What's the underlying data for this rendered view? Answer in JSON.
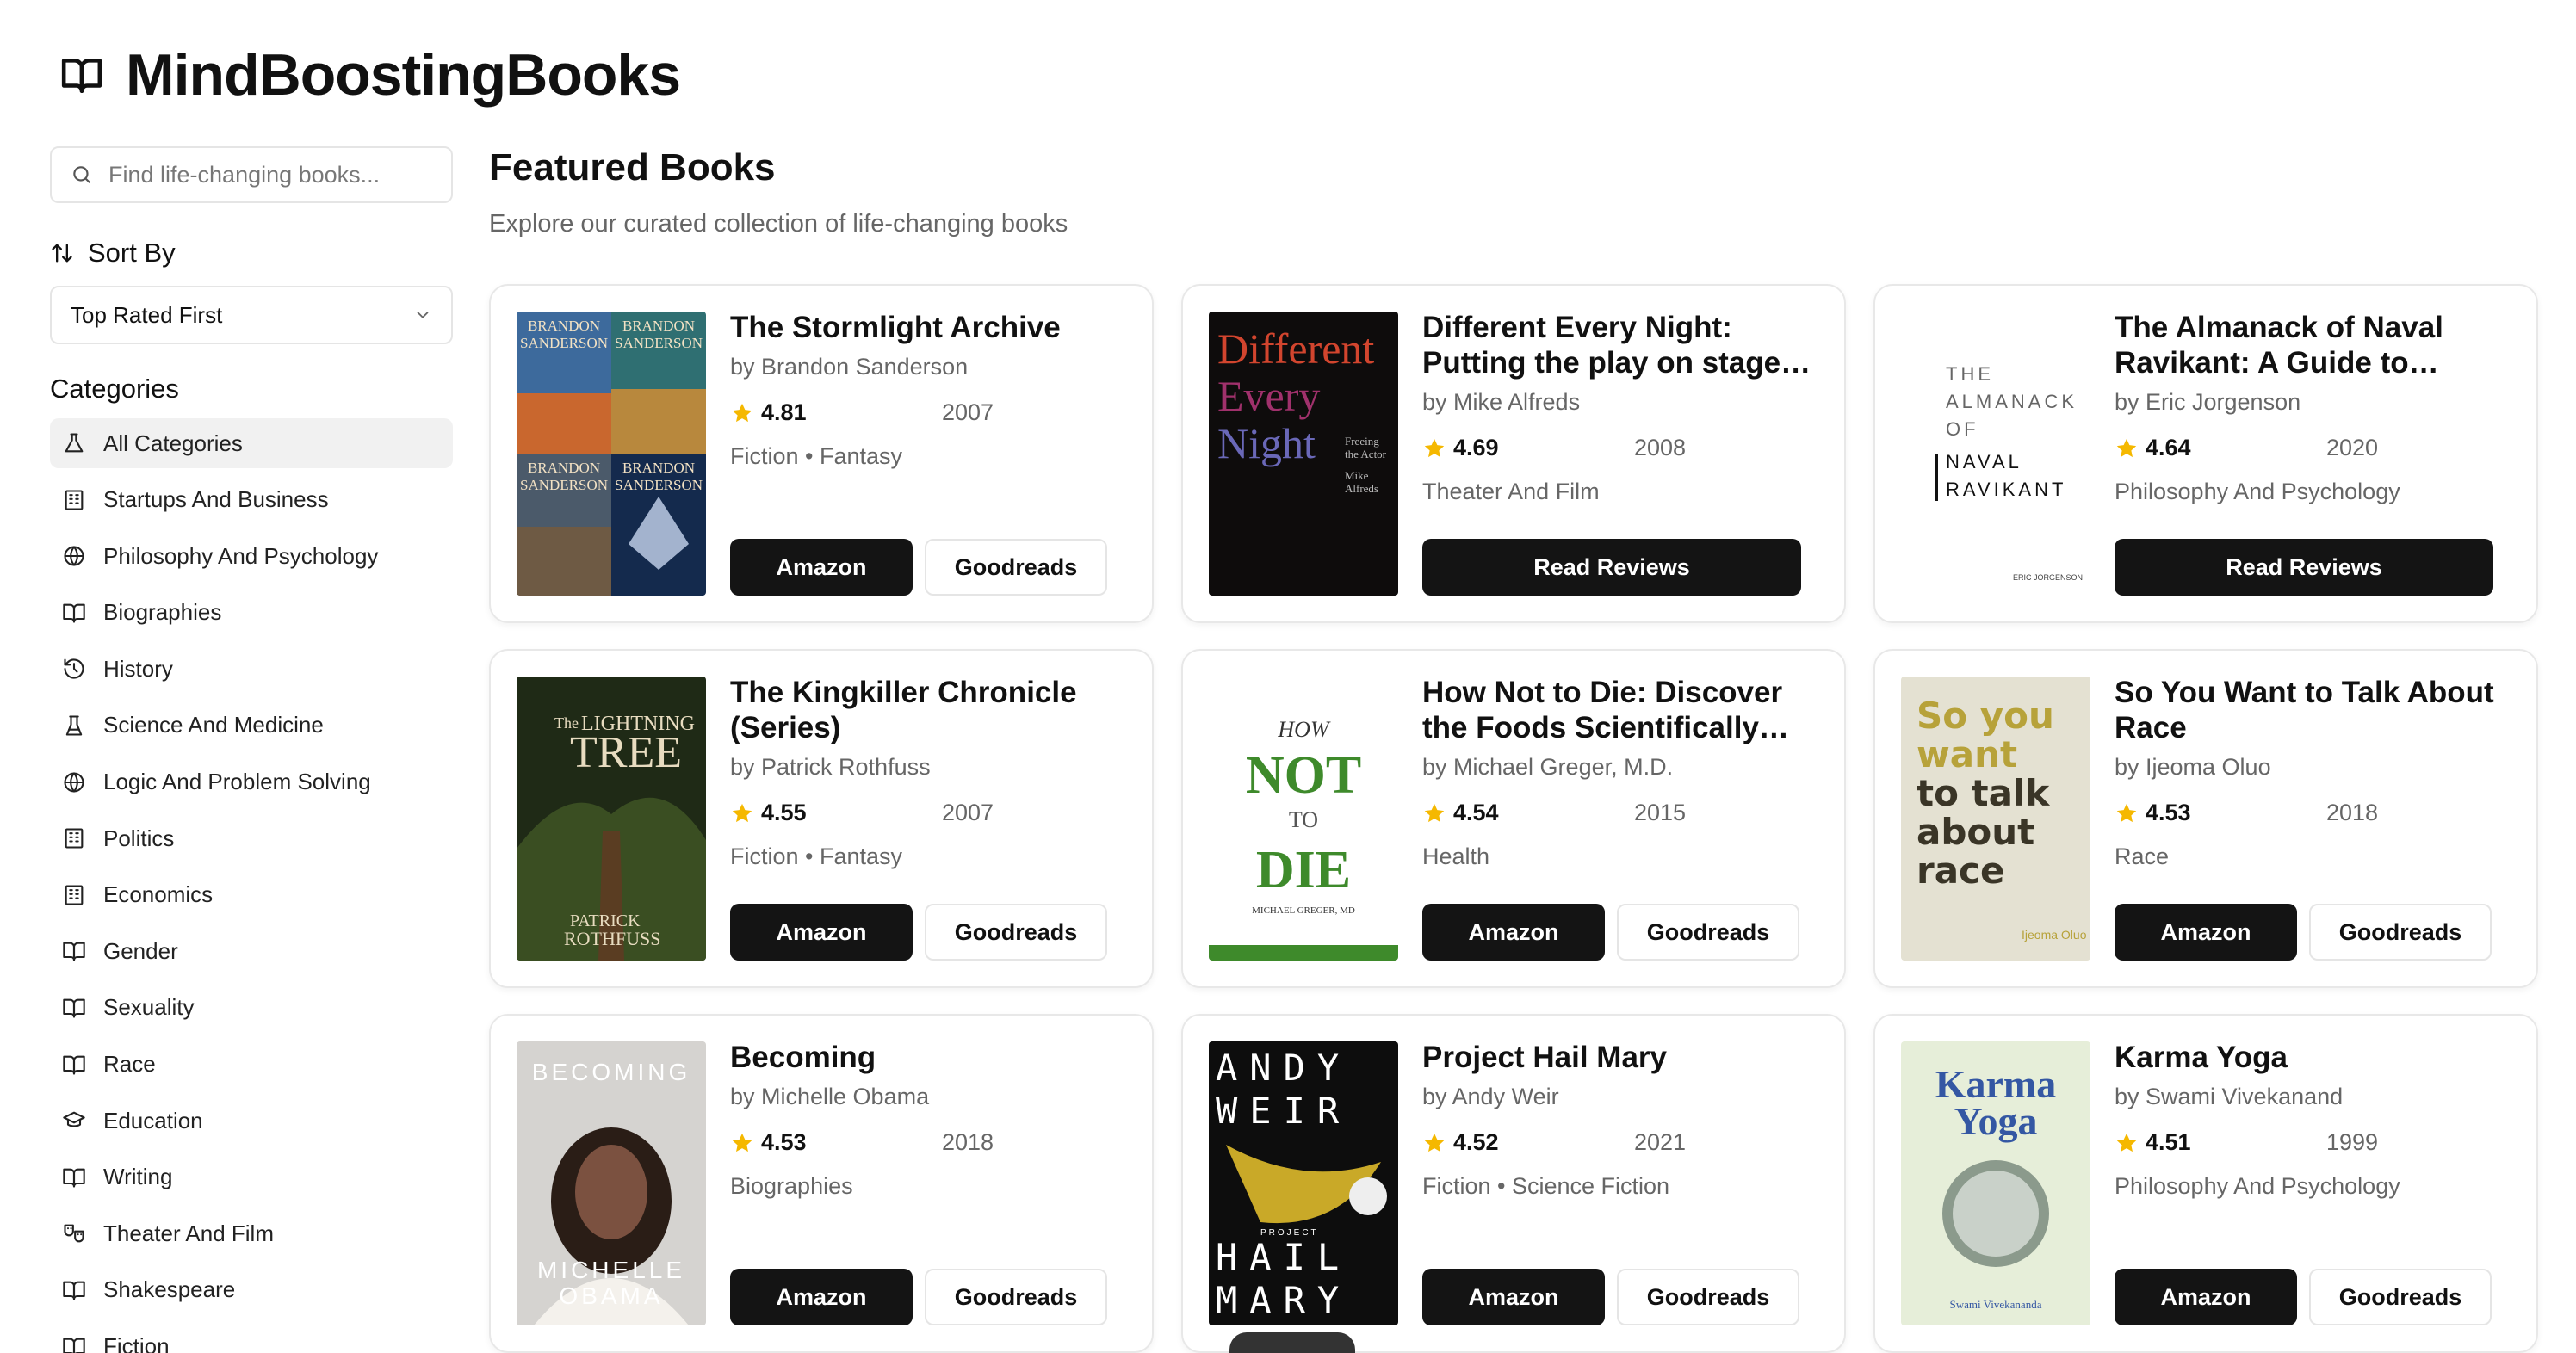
{
  "app": {
    "title": "MindBoostingBooks",
    "logo_icon": "book-open-icon"
  },
  "search": {
    "placeholder": "Find life-changing books..."
  },
  "sort": {
    "label": "Sort By",
    "selected": "Top Rated First"
  },
  "categories": {
    "title": "Categories",
    "items": [
      {
        "label": "All Categories",
        "icon": "flask-icon",
        "active": true
      },
      {
        "label": "Startups And Business",
        "icon": "building-icon"
      },
      {
        "label": "Philosophy And Psychology",
        "icon": "globe-icon"
      },
      {
        "label": "Biographies",
        "icon": "book-open-icon"
      },
      {
        "label": "History",
        "icon": "history-icon"
      },
      {
        "label": "Science And Medicine",
        "icon": "beaker-icon"
      },
      {
        "label": "Logic And Problem Solving",
        "icon": "globe-icon"
      },
      {
        "label": "Politics",
        "icon": "building-icon"
      },
      {
        "label": "Economics",
        "icon": "building-icon"
      },
      {
        "label": "Gender",
        "icon": "book-open-icon"
      },
      {
        "label": "Sexuality",
        "icon": "book-open-icon"
      },
      {
        "label": "Race",
        "icon": "book-open-icon"
      },
      {
        "label": "Education",
        "icon": "graduation-cap-icon"
      },
      {
        "label": "Writing",
        "icon": "book-open-icon"
      },
      {
        "label": "Theater And Film",
        "icon": "theater-icon"
      },
      {
        "label": "Shakespeare",
        "icon": "book-open-icon"
      },
      {
        "label": "Fiction",
        "icon": "book-open-icon"
      }
    ]
  },
  "main": {
    "heading": "Featured Books",
    "subtitle": "Explore our curated collection of life-changing books"
  },
  "books": [
    {
      "title": "The Stormlight Archive",
      "author": "by Brandon Sanderson",
      "rating": "4.81",
      "year": "2007",
      "genre": "Fiction • Fantasy",
      "buttons": [
        "Amazon",
        "Goodreads"
      ]
    },
    {
      "title": "Different Every Night: Putting the play on stage and...",
      "author": "by Mike Alfreds",
      "rating": "4.69",
      "year": "2008",
      "genre": "Theater And Film",
      "buttons": [
        "Read Reviews"
      ]
    },
    {
      "title": "The Almanack of Naval Ravikant: A Guide to Wealt...",
      "author": "by Eric Jorgenson",
      "rating": "4.64",
      "year": "2020",
      "genre": "Philosophy And Psychology",
      "buttons": [
        "Read Reviews"
      ]
    },
    {
      "title": "The Kingkiller Chronicle (Series)",
      "author": "by Patrick Rothfuss",
      "rating": "4.55",
      "year": "2007",
      "genre": "Fiction • Fantasy",
      "buttons": [
        "Amazon",
        "Goodreads"
      ]
    },
    {
      "title": "How Not to Die: Discover the Foods Scientifically Proven...",
      "author": "by Michael Greger, M.D.",
      "rating": "4.54",
      "year": "2015",
      "genre": "Health",
      "buttons": [
        "Amazon",
        "Goodreads"
      ]
    },
    {
      "title": "So You Want to Talk About Race",
      "author": "by Ijeoma Oluo",
      "rating": "4.53",
      "year": "2018",
      "genre": "Race",
      "buttons": [
        "Amazon",
        "Goodreads"
      ]
    },
    {
      "title": "Becoming",
      "author": "by Michelle Obama",
      "rating": "4.53",
      "year": "2018",
      "genre": "Biographies",
      "buttons": [
        "Amazon",
        "Goodreads"
      ]
    },
    {
      "title": "Project Hail Mary",
      "author": "by Andy Weir",
      "rating": "4.52",
      "year": "2021",
      "genre": "Fiction • Science Fiction",
      "buttons": [
        "Amazon",
        "Goodreads"
      ]
    },
    {
      "title": "Karma Yoga",
      "author": "by Swami Vivekanand",
      "rating": "4.51",
      "year": "1999",
      "genre": "Philosophy And Psychology",
      "buttons": [
        "Amazon",
        "Goodreads"
      ]
    }
  ],
  "covers": [
    {
      "lines": [
        "BRANDON",
        "SANDERSON",
        "BRANDON",
        "SANDERSON",
        "BRANDON",
        "SANDERSON",
        "BRANDON",
        "SANDERSON"
      ]
    },
    {
      "lines": [
        "Different",
        "Every",
        "Night",
        "Freeing",
        "the Actor",
        "Mike",
        "Alfreds"
      ]
    },
    {
      "lines": [
        "THE",
        "ALMANACK",
        "OF",
        "NAVAL",
        "RAVIKANT",
        "ERIC JORGENSON"
      ]
    },
    {
      "lines": [
        "The",
        "LIGHTNING",
        "TREE",
        "PATRICK",
        "ROTHFUSS"
      ]
    },
    {
      "lines": [
        "HOW",
        "NOT",
        "TO",
        "DIE",
        "MICHAEL GREGER, MD"
      ]
    },
    {
      "lines": [
        "So you",
        "want",
        "to talk",
        "about",
        "race",
        "Ijeoma Oluo"
      ]
    },
    {
      "lines": [
        "BECOMING",
        "MICHELLE",
        "OBAMA"
      ]
    },
    {
      "lines": [
        "ANDY",
        "WEIR",
        "PROJECT",
        "HAIL",
        "MARY"
      ]
    },
    {
      "lines": [
        "Karma",
        "Yoga",
        "Swami Vivekananda"
      ]
    }
  ],
  "colors": {
    "accent": "#141414",
    "star": "#F5B800",
    "muted": "#666666",
    "border": "#E5E5E5"
  }
}
